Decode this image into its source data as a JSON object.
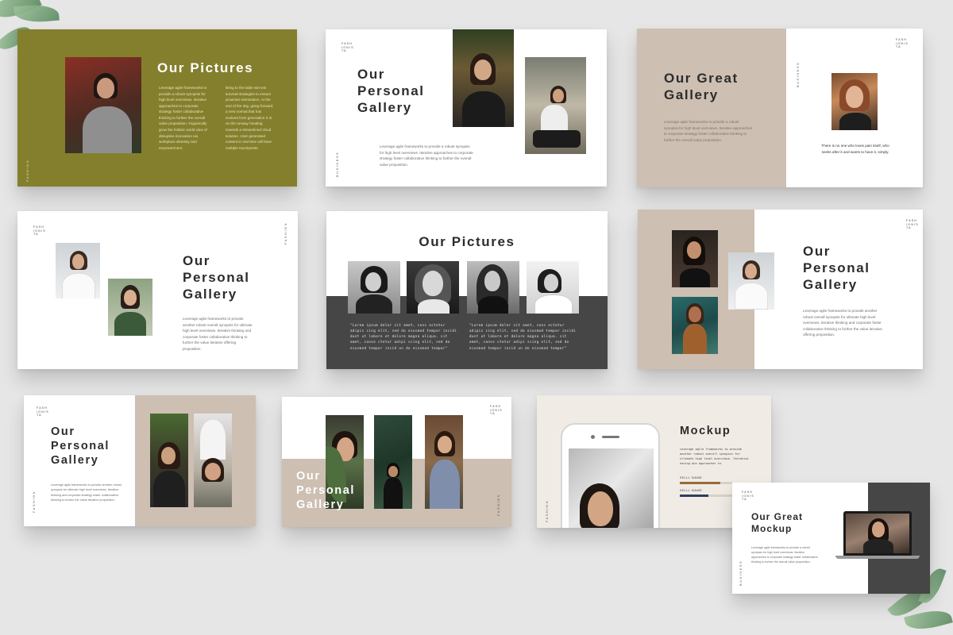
{
  "colors": {
    "page_background": "#e6e6e6",
    "olive": "#847f2c",
    "taupe": "#cdbfb2",
    "charcoal": "#464646",
    "cream": "#f0ebe5",
    "bar_brown": "#9a6a3a",
    "bar_navy": "#2e3e5c"
  },
  "brand": {
    "logo": "FASHIONISTA",
    "side_label": "FASHION",
    "side_label_alt": "BUSINESS"
  },
  "slides": {
    "s1": {
      "title": "Our Pictures",
      "text_left": "Leverage agile frameworks to provide a robust synopsis for high level overviews. Iterative approaches to corporate strategy foster collaborative thinking to further the overall value proposition. Organically grow the holistic world view of disruptive innovation via workplace diversity and empowerment.",
      "text_right": "Bring to the table win-win survival strategies to ensure proactive domination. At the end of the day, going forward, a new normal that has evolved from generation X is on the runway heading towards a streamlined cloud solution. User generated content in real-time will have multiple touchpoints."
    },
    "s2": {
      "title": "Our Personal Gallery",
      "text": "Leverage agile frameworks to provide a robust synopsis for high level overviews. Iterative approaches to corporate strategy foster collaborative thinking to further the overall value proposition."
    },
    "s3": {
      "title": "Our Great Gallery",
      "text": "Leverage agile frameworks to provide a robust synopsis for high level overviews. Iterative approaches to corporate strategy foster collaborative thinking to further the overall value proposition.",
      "caption": "There is no one who loves pain itself, who seeks after it and wants to have it, simply."
    },
    "s4": {
      "title": "Our Personal Gallery",
      "text": "Leverage agile frameworks to provide another robust overall synopsis for ultimate high level overviews. Iterative thinking and corporate foster collaborative thinking to further the value iterative offering proposition."
    },
    "s5": {
      "title": "Our Pictures",
      "quote_left": "\"Lorem ipsum dolor sit amet, cons ectetur adipis cing elit, sed do eiusmod tempor incidi dunt ut labore et dolore magna aliqua. sit amet, conse ctetur adipi scing elit, sed do eiusmod tempor incid un do eiusmod tempor\"",
      "quote_right": "\"Lorem ipsum dolor sit amet, cons ectetur adipis cing elit, sed do eiusmod tempor incidi dunt ut labore et dolore magna aliqua. sit amet, conse ctetur adipi scing elit, sed do eiusmod tempor incid un do eiusmod tempor\""
    },
    "s6": {
      "title": "Our Personal Gallery",
      "text": "Leverage agile frameworks to provide another robust overall synopsis for ultimate high level overviews. Iterative thinking and corporate foster collaborative thinking to further the value iterative offering proposition."
    },
    "s7": {
      "title": "Our Personal Gallery",
      "text": "Leverage agile frameworks to provide another robust synopsis for ultimate high level overviews. Iterative thinking and corporate strategy foster collaborative thinking to further the value iterative proposition."
    },
    "s8": {
      "title": "Our Personal Gallery"
    },
    "s9": {
      "title": "Mockup",
      "text": "Leverage agile frameworks to provide another robust overall synopsis for ultimate high level overviews. Iterative having due approaches to",
      "skill1_label": "SKILL NAME",
      "skill2_label": "SKILL NAME",
      "skill1_level": 0.78,
      "skill2_level": 0.55
    },
    "s10": {
      "title": "Our Great Mockup",
      "text": "Leverage agile frameworks to provide a robust synopsis for high level overviews. Iterative approaches to corporate strategy foster collaborative thinking to further the overall value proposition."
    }
  }
}
